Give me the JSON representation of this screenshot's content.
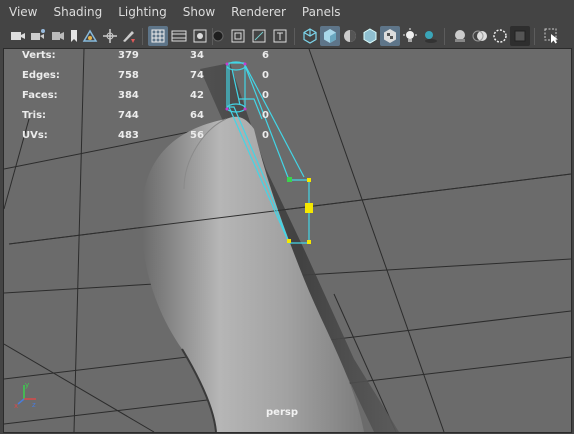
{
  "menu": [
    "View",
    "Shading",
    "Lighting",
    "Show",
    "Renderer",
    "Panels"
  ],
  "toolbar_icons": [
    "camera-icon",
    "camera-attributes-icon",
    "bookmark-icon",
    "image-plane-icon",
    "two-d-pan-zoom-icon",
    "grease-pencil-icon",
    "grid-icon",
    "film-gate-icon",
    "resolution-gate-icon",
    "gate-mask-icon",
    "field-chart-icon",
    "safe-action-icon",
    "safe-title-icon",
    "wireframe-icon",
    "smooth-shade-icon",
    "default-material-icon",
    "wireframe-on-shaded-icon",
    "textured-icon",
    "use-all-lights-icon",
    "shadows-icon",
    "screen-space-ao-icon",
    "motion-blur-icon",
    "anti-aliasing-icon",
    "depth-of-field-icon",
    "isolate-select-icon",
    "xray-icon",
    "xray-joints-icon"
  ],
  "hud": {
    "rows": [
      {
        "label": "Verts:",
        "total": "379",
        "selected": "34",
        "component": "6"
      },
      {
        "label": "Edges:",
        "total": "758",
        "selected": "74",
        "component": "0"
      },
      {
        "label": "Faces:",
        "total": "384",
        "selected": "42",
        "component": "0"
      },
      {
        "label": "Tris:",
        "total": "744",
        "selected": "64",
        "component": "0"
      },
      {
        "label": "UVs:",
        "total": "483",
        "selected": "56",
        "component": "0"
      }
    ]
  },
  "camera_label": "persp",
  "axis": {
    "x": "x",
    "y": "y",
    "z": "z"
  },
  "colors": {
    "background": "#444444",
    "viewport": "#6b6b6b",
    "selection_wire": "#43d5e6",
    "active_accent": "#5e7589",
    "vertex_yellow": "#f5e800",
    "vertex_green": "#3bd34d",
    "pivot_magenta": "#c43cd0"
  }
}
